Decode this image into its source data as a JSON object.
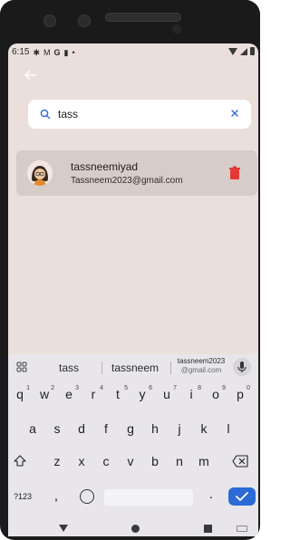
{
  "status_bar": {
    "time": "6:15",
    "left_icons": [
      "settings-icon",
      "gmail-icon",
      "google-icon",
      "sd-card-icon",
      "dot-icon"
    ],
    "right_icons": [
      "wifi-icon",
      "signal-icon",
      "battery-icon"
    ]
  },
  "header": {
    "back_icon": "arrow-left-icon"
  },
  "search": {
    "value": "tass",
    "placeholder": "",
    "search_icon": "search-icon",
    "clear_icon": "close-icon",
    "accent_color": "#2c6bd6"
  },
  "results": [
    {
      "username": "tassneemiyad",
      "email": "Tassneem2023@gmail.com",
      "avatar_icon": "avatar-girl",
      "action_icon": "trash-icon",
      "action_color": "#e53935"
    }
  ],
  "keyboard": {
    "suggestions": [
      "tass",
      "tassneem"
    ],
    "email_suggestion": {
      "line1": "tassneem2023",
      "line2": "@gmail.com"
    },
    "row1": [
      "q",
      "w",
      "e",
      "r",
      "t",
      "y",
      "u",
      "i",
      "o",
      "p"
    ],
    "row1_hints": [
      "1",
      "2",
      "3",
      "4",
      "5",
      "6",
      "7",
      "8",
      "9",
      "0"
    ],
    "row2": [
      "a",
      "s",
      "d",
      "f",
      "g",
      "h",
      "j",
      "k",
      "l"
    ],
    "row3": [
      "z",
      "x",
      "c",
      "v",
      "b",
      "n",
      "m"
    ],
    "row4_symbols_label": "?123",
    "comma": ",",
    "period": ".",
    "enter_color": "#2c6bd6"
  },
  "nav_bar": {
    "icons": [
      "nav-back-icon",
      "nav-home-icon",
      "nav-recents-icon",
      "keyboard-toggle-icon"
    ]
  },
  "colors": {
    "screen_bg": "#ebdfdc",
    "card_bg": "#d8ccc8",
    "keyboard_bg": "#e8e6ea"
  }
}
